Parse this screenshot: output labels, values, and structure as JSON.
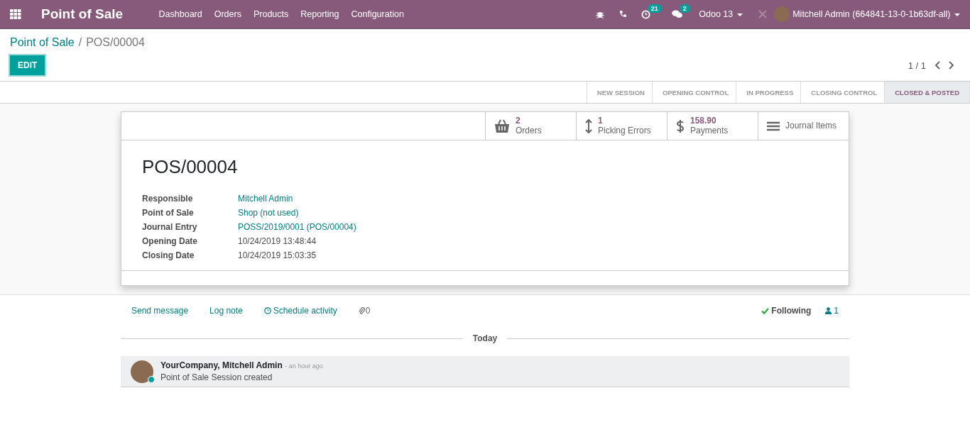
{
  "navbar": {
    "app_title": "Point of Sale",
    "menu": [
      "Dashboard",
      "Orders",
      "Products",
      "Reporting",
      "Configuration"
    ],
    "activity_count": "21",
    "message_count": "2",
    "database": "Odoo 13",
    "user": "Mitchell Admin (664841-13-0-1b63df-all)"
  },
  "breadcrumb": {
    "parent": "Point of Sale",
    "separator": "/",
    "current": "POS/00004"
  },
  "edit_button": "EDIT",
  "pager": "1 / 1",
  "stages": [
    {
      "label": "NEW SESSION",
      "selected": false
    },
    {
      "label": "OPENING CONTROL",
      "selected": false
    },
    {
      "label": "IN PROGRESS",
      "selected": false
    },
    {
      "label": "CLOSING CONTROL",
      "selected": false
    },
    {
      "label": "CLOSED & POSTED",
      "selected": true
    }
  ],
  "smart_buttons": [
    {
      "kind": "basket",
      "value": "2",
      "label": "Orders"
    },
    {
      "kind": "arrows",
      "value": "1",
      "label": "Picking Errors"
    },
    {
      "kind": "dollar",
      "value": "158.90",
      "label": "Payments"
    },
    {
      "kind": "list",
      "label": "Journal Items"
    }
  ],
  "record_title": "POS/00004",
  "fields": [
    {
      "label": "Responsible",
      "value": "Mitchell Admin",
      "link": true
    },
    {
      "label": "Point of Sale",
      "value": "Shop (not used)",
      "link": true
    },
    {
      "label": "Journal Entry",
      "value": "POSS/2019/0001 (POS/00004)",
      "link": true
    },
    {
      "label": "Opening Date",
      "value": "10/24/2019 13:48:44",
      "link": false
    },
    {
      "label": "Closing Date",
      "value": "10/24/2019 15:03:35",
      "link": false
    }
  ],
  "chatter": {
    "send_message": "Send message",
    "log_note": "Log note",
    "schedule_activity": "Schedule activity",
    "attachments": "0",
    "following": "Following",
    "followers": "1",
    "separator": "Today",
    "messages": [
      {
        "author": "YourCompany, Mitchell Admin",
        "time": "- an hour ago",
        "body": "Point of Sale Session created",
        "online": true
      }
    ]
  }
}
